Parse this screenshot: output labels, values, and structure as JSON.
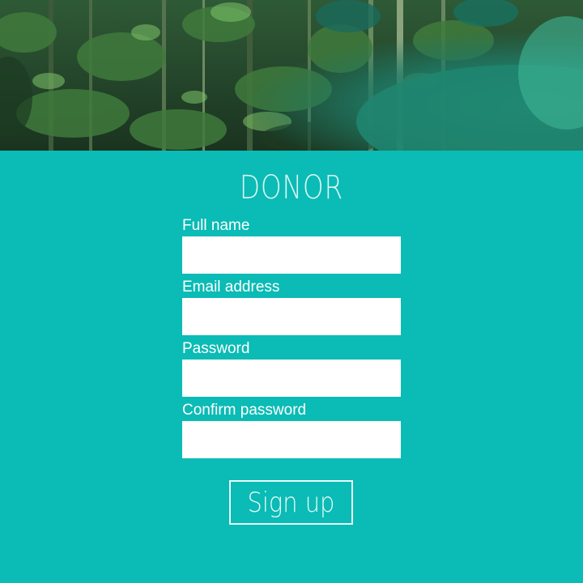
{
  "hero": {
    "image": "rainforest-foliage-photo"
  },
  "form": {
    "title": "DONOR",
    "fields": [
      {
        "label": "Full name",
        "value": "",
        "placeholder": ""
      },
      {
        "label": "Email address",
        "value": "",
        "placeholder": ""
      },
      {
        "label": "Password",
        "value": "",
        "placeholder": ""
      },
      {
        "label": "Confirm password",
        "value": "",
        "placeholder": ""
      }
    ],
    "submit_label": "Sign up"
  },
  "colors": {
    "background": "#0bbbb5",
    "text": "#ffffff",
    "input_background": "#ffffff"
  }
}
